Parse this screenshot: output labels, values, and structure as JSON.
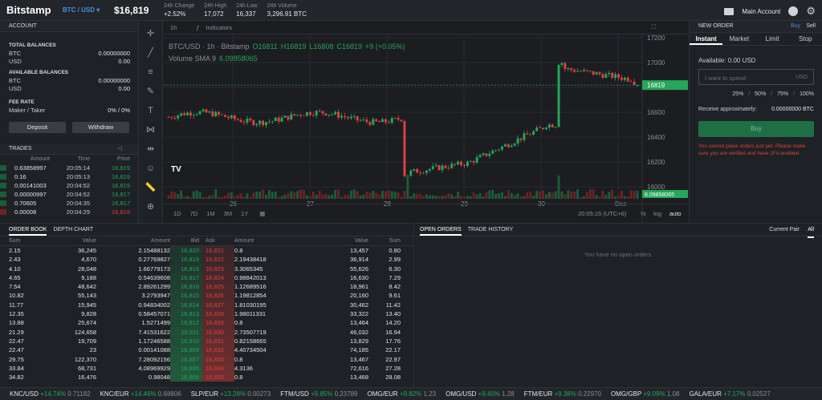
{
  "top": {
    "logo": "Bitstamp",
    "pair": "BTC / USD ▾",
    "price": "$16,819",
    "stats": [
      {
        "label": "24h Change",
        "value": "+2.52%",
        "cls": "green"
      },
      {
        "label": "24h High",
        "value": "17,072",
        "cls": ""
      },
      {
        "label": "24h Low",
        "value": "16,337",
        "cls": ""
      },
      {
        "label": "24h Volume",
        "value": "3,296.91 BTC",
        "cls": ""
      }
    ],
    "main_account": "Main Account"
  },
  "account": {
    "title": "ACCOUNT",
    "total_label": "TOTAL BALANCES",
    "available_label": "AVAILABLE BALANCES",
    "total": [
      {
        "cur": "BTC",
        "val": "0.00000000"
      },
      {
        "cur": "USD",
        "val": "0.00"
      }
    ],
    "available": [
      {
        "cur": "BTC",
        "val": "0.00000000"
      },
      {
        "cur": "USD",
        "val": "0.00"
      }
    ],
    "fee_label": "FEE RATE",
    "fee_name": "Maker / Taker",
    "fee_val": "0% / 0%",
    "deposit": "Deposit",
    "withdraw": "Withdraw"
  },
  "trades": {
    "title": "TRADES",
    "cols": [
      "Amount",
      "Time",
      "Price"
    ],
    "rows": [
      [
        "0.63858997",
        "20:05:14",
        "16,819",
        "green"
      ],
      [
        "0.16",
        "20:05:13",
        "16,819",
        "green"
      ],
      [
        "0.00141003",
        "20:04:52",
        "16,819",
        "green"
      ],
      [
        "0.00000997",
        "20:04:52",
        "16,817",
        "green"
      ],
      [
        "0.70605",
        "20:04:35",
        "16,817",
        "green"
      ],
      [
        "0.00008",
        "20:04:29",
        "16,816",
        "red"
      ]
    ]
  },
  "chart": {
    "interval": "1h",
    "indicators": "Indicators",
    "symbol": "BTC/USD · 1h · Bitstamp",
    "o": "O16811",
    "h": "H16819",
    "l": "L16808",
    "c": "C16819",
    "chg": "+9 (+0.05%)",
    "vol": "Volume SMA 9",
    "volval": "6.09858065",
    "price_tag": "16819",
    "vol_tag": "6.09858065",
    "yticks": [
      "17200",
      "17000",
      "16800",
      "16600",
      "16400",
      "16200",
      "16000"
    ],
    "xticks": [
      "26",
      "27",
      "28",
      "29",
      "30",
      "Dec"
    ],
    "ranges": [
      "1D",
      "7D",
      "1M",
      "3M",
      "1Y"
    ],
    "time": "20:05:15 (UTC+6)",
    "pct": "%",
    "log": "log",
    "auto": "auto"
  },
  "order": {
    "title": "NEW ORDER",
    "buy": "Buy",
    "sell": "Sell",
    "tabs": [
      "Instant",
      "Market",
      "Limit",
      "Stop"
    ],
    "available": "Available: 0.00 USD",
    "placeholder": "I want to spend",
    "currency": "USD",
    "pcts": [
      "25%",
      "50%",
      "75%",
      "100%"
    ],
    "receive_label": "Receive approximately:",
    "receive_val": "0.00000000 BTC",
    "buy_btn": "Buy",
    "warning": "You cannot place orders just yet. Please make sure you are verified and have 2FA enabled."
  },
  "orderbook": {
    "tabs": [
      "ORDER BOOK",
      "DEPTH CHART"
    ],
    "cols": [
      "Sum",
      "Value",
      "Amount",
      "Bid",
      "Ask",
      "Amount",
      "Value",
      "Sum"
    ],
    "rows": [
      [
        "2.15",
        "36,245",
        "2.15488132",
        "16,820",
        "16,821",
        "0.8",
        "13,457",
        "0.80"
      ],
      [
        "2.43",
        "4,670",
        "0.27769827",
        "16,819",
        "16,822",
        "2.19438418",
        "36,914",
        "2.99"
      ],
      [
        "4.10",
        "28,048",
        "1.66779173",
        "16,818",
        "16,823",
        "3.3065345",
        "55,626",
        "6.30"
      ],
      [
        "4.65",
        "9,188",
        "0.54639608",
        "16,817",
        "16,824",
        "0.98842013",
        "16,630",
        "7.29"
      ],
      [
        "7.54",
        "48,642",
        "2.89261299",
        "16,816",
        "16,825",
        "1.12689516",
        "18,961",
        "8.42"
      ],
      [
        "10.82",
        "55,143",
        "3.2793947",
        "16,815",
        "16,826",
        "1.19812854",
        "20,160",
        "9.61"
      ],
      [
        "11.77",
        "15,945",
        "0.94834002",
        "16,814",
        "16,827",
        "1.81030195",
        "30,462",
        "11.42"
      ],
      [
        "12.35",
        "9,828",
        "0.58457071",
        "16,813",
        "16,828",
        "1.98011331",
        "33,322",
        "13.40"
      ],
      [
        "13.88",
        "25,674",
        "1.5271499",
        "16,812",
        "16,829",
        "0.8",
        "13,464",
        "14.20"
      ],
      [
        "21.29",
        "124,658",
        "7.41531622",
        "16,811",
        "16,830",
        "2.73507719",
        "46,032",
        "16.94"
      ],
      [
        "22.47",
        "19,709",
        "1.17246588",
        "16,810",
        "16,831",
        "0.82158665",
        "13,829",
        "17.76"
      ],
      [
        "22.47",
        "23",
        "0.00141088",
        "16,809",
        "16,832",
        "4.40734504",
        "74,185",
        "22.17"
      ],
      [
        "29.75",
        "122,370",
        "7.28092156",
        "16,807",
        "16,833",
        "0.8",
        "13,467",
        "22.97"
      ],
      [
        "33.84",
        "68,731",
        "4.08969929",
        "16,806",
        "16,834",
        "4.3136",
        "72,616",
        "27.28"
      ],
      [
        "34.82",
        "16,476",
        "0.98048",
        "16,805",
        "16,835",
        "0.8",
        "13,468",
        "28.08"
      ]
    ]
  },
  "open_orders": {
    "tabs": [
      "OPEN ORDERS",
      "TRADE HISTORY"
    ],
    "filters": [
      "Current Pair",
      "All"
    ],
    "empty": "You have no open orders."
  },
  "ticker": [
    {
      "pair": "KNC/USD",
      "chg": "+14.74%",
      "price": "0.71182"
    },
    {
      "pair": "KNC/EUR",
      "chg": "+14.46%",
      "price": "0.68806"
    },
    {
      "pair": "SLP/EUR",
      "chg": "+13.28%",
      "price": "0.00273"
    },
    {
      "pair": "FTM/USD",
      "chg": "+9.85%",
      "price": "0.23789"
    },
    {
      "pair": "OMG/EUR",
      "chg": "+9.82%",
      "price": "1.23"
    },
    {
      "pair": "OMG/USD",
      "chg": "+9.40%",
      "price": "1.28"
    },
    {
      "pair": "FTM/EUR",
      "chg": "+9.38%",
      "price": "0.22970"
    },
    {
      "pair": "OMG/GBP",
      "chg": "+9.09%",
      "price": "1.08"
    },
    {
      "pair": "GALA/EUR",
      "chg": "+7.17%",
      "price": "0.02527"
    }
  ]
}
